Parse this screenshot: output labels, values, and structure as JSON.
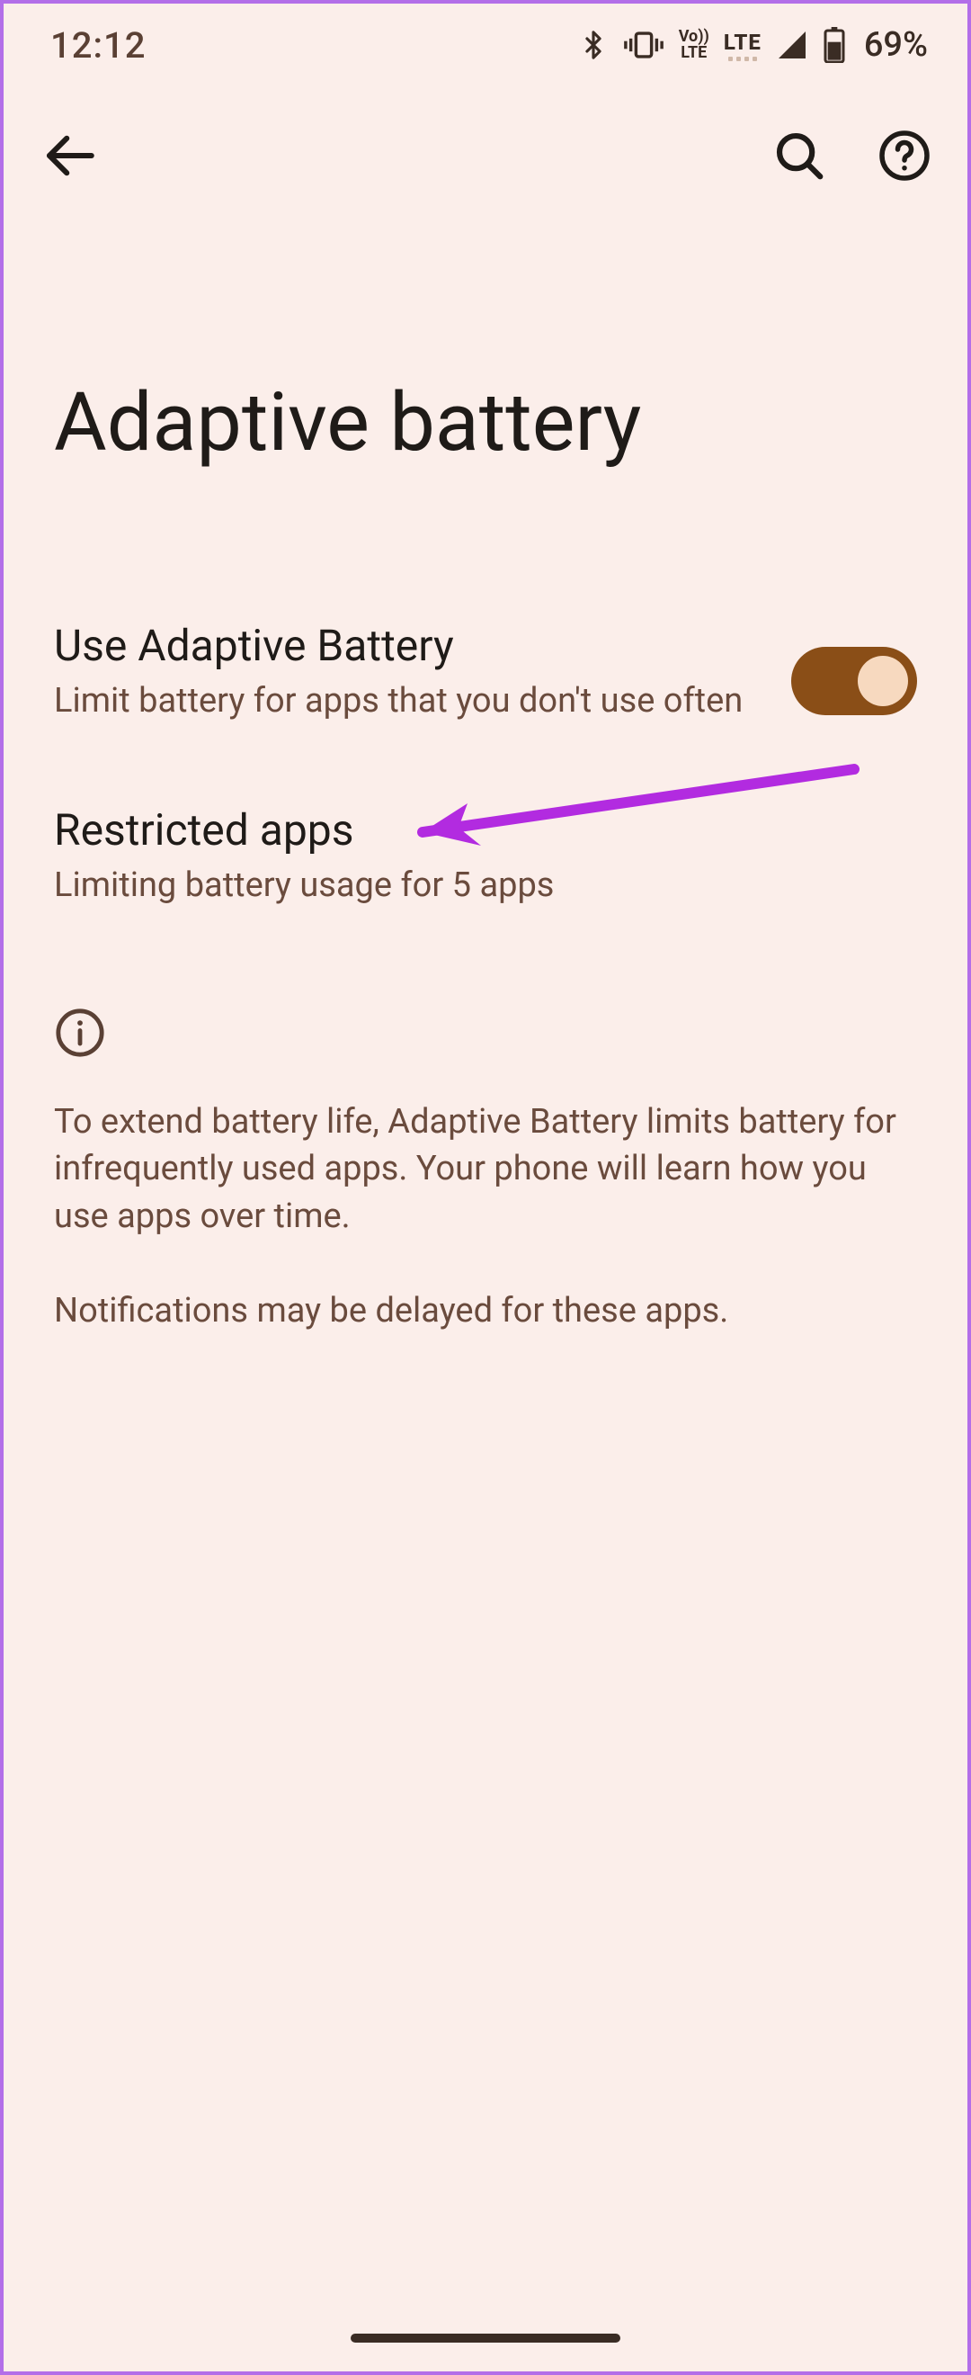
{
  "status": {
    "time": "12:12",
    "bluetooth_icon": "bluetooth",
    "vibrate_icon": "vibrate",
    "volte_top": "Vo))",
    "volte_bottom": "LTE",
    "network": "LTE",
    "battery_percent": "69%"
  },
  "header": {
    "back_icon": "back-arrow",
    "search_icon": "search",
    "help_icon": "help"
  },
  "page": {
    "title": "Adaptive battery"
  },
  "settings": {
    "adaptive": {
      "title": "Use Adaptive Battery",
      "subtitle": "Limit battery for apps that you don't use often",
      "enabled": true
    },
    "restricted": {
      "title": "Restricted apps",
      "subtitle": "Limiting battery usage for 5 apps"
    }
  },
  "info": {
    "icon": "info",
    "text": "To extend battery life, Adaptive Battery limits battery for infrequently used apps. Your phone will learn how you use apps over time.\n\nNotifications may be delayed for these apps."
  },
  "annotation": {
    "arrow_color": "#b22be0"
  }
}
